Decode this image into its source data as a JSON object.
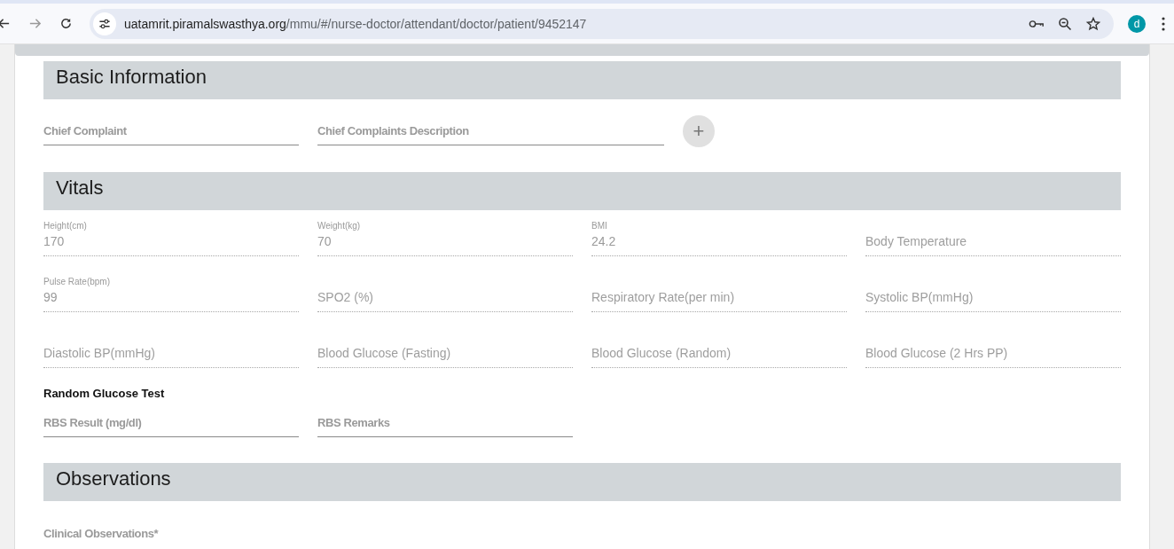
{
  "browser": {
    "url_host": "uatamrit.piramalswasthya.org",
    "url_path": "/mmu/#/nurse-doctor/attendant/doctor/patient/9452147",
    "avatar": "d"
  },
  "basic_information": {
    "title": "Basic Information",
    "add_button": "+",
    "fields": [
      {
        "label": "Chief Complaint",
        "kind": "short",
        "disabled": false
      },
      {
        "label": "Chief Complaints Description",
        "kind": "wide",
        "disabled": false
      }
    ]
  },
  "vitals": {
    "title": "Vitals",
    "fields": [
      {
        "label": "Height(cm)",
        "value": "170",
        "disabled": true
      },
      {
        "label": "Weight(kg)",
        "value": "70",
        "disabled": true
      },
      {
        "label": "BMI",
        "value": "24.2",
        "disabled": true
      },
      {
        "label": "Body Temperature",
        "disabled": true
      },
      {
        "label": "Pulse Rate(bpm)",
        "value": "99",
        "disabled": true
      },
      {
        "label": "SPO2 (%)",
        "disabled": true
      },
      {
        "label": "Respiratory Rate(per min)",
        "disabled": true
      },
      {
        "label": "Systolic BP(mmHg)",
        "disabled": true
      },
      {
        "label": "Diastolic BP(mmHg)",
        "disabled": true
      },
      {
        "label": "Blood Glucose (Fasting)",
        "disabled": true
      },
      {
        "label": "Blood Glucose (Random)",
        "disabled": true
      },
      {
        "label": "Blood Glucose (2 Hrs PP)",
        "disabled": true
      }
    ],
    "random_glucose_test": {
      "title": "Random Glucose Test",
      "fields": [
        {
          "label": "RBS Result (mg/dl)",
          "disabled": false
        },
        {
          "label": "RBS Remarks",
          "disabled": false
        }
      ]
    }
  },
  "observations": {
    "title": "Observations",
    "fields": [
      {
        "label": "Clinical Observations*",
        "disabled": false
      }
    ]
  }
}
